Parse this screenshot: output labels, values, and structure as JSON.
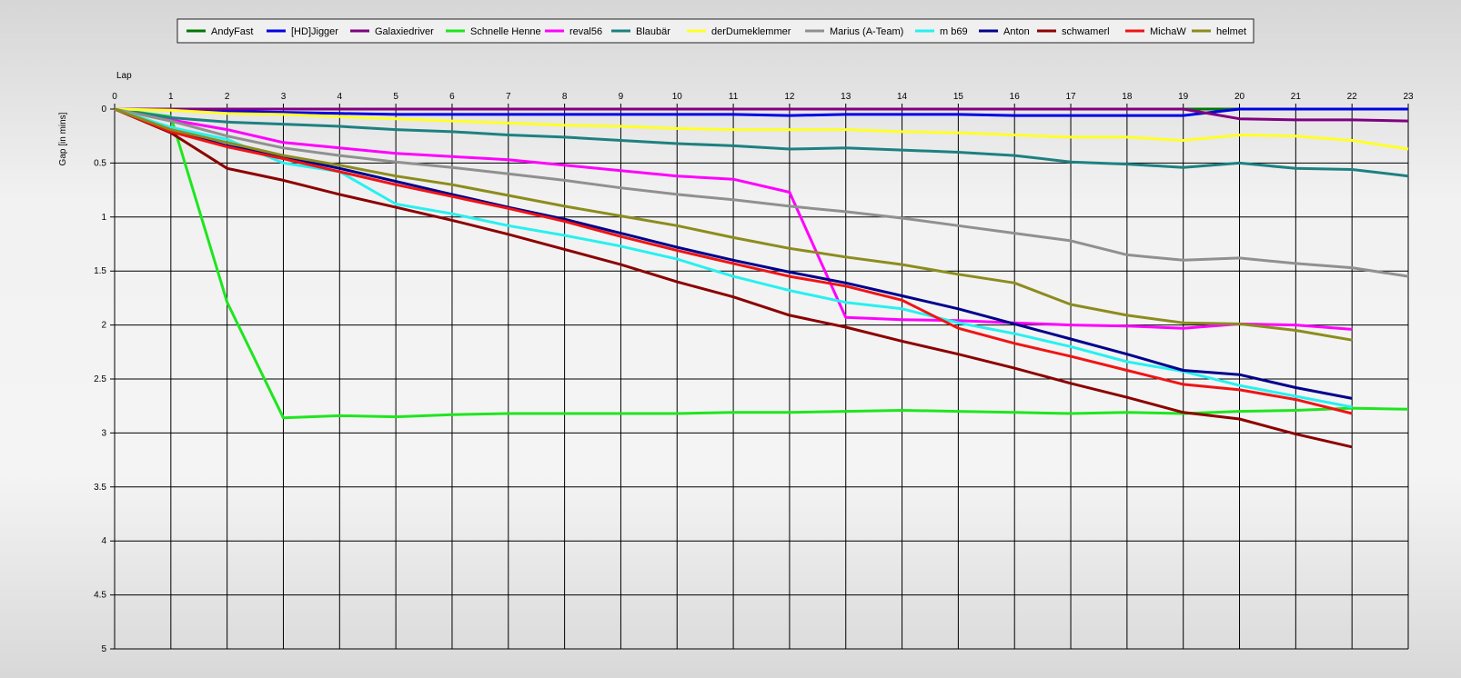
{
  "chart_data": {
    "type": "line",
    "xlabel": "Lap",
    "ylabel": "Gap [in mins]",
    "xlim": [
      0,
      23
    ],
    "ylim": [
      0,
      5
    ],
    "y_inverted": true,
    "grid": true,
    "legend_position": "top",
    "x_ticks": [
      "0",
      "1",
      "2",
      "3",
      "4",
      "5",
      "6",
      "7",
      "8",
      "9",
      "10",
      "11",
      "12",
      "13",
      "14",
      "15",
      "16",
      "17",
      "18",
      "19",
      "20",
      "21",
      "22",
      "23"
    ],
    "y_ticks": [
      "0",
      "0.5",
      "1",
      "1.5",
      "2",
      "2.5",
      "3",
      "3.5",
      "4",
      "4.5",
      "5"
    ],
    "series": [
      {
        "name": "AndyFast",
        "color": "#007800",
        "x": [
          0,
          1,
          2,
          3,
          4,
          5,
          6,
          7,
          8,
          9,
          10,
          11,
          12,
          13,
          14,
          15,
          16,
          17,
          18,
          19,
          20,
          21,
          22,
          23
        ],
        "values": [
          0,
          0,
          0,
          0,
          0,
          0,
          0,
          0,
          0,
          0,
          0,
          0,
          0,
          0,
          0,
          0,
          0,
          0,
          0,
          0,
          0,
          0,
          0,
          0
        ]
      },
      {
        "name": "[HD]Jigger",
        "color": "#0000e6",
        "x": [
          0,
          1,
          2,
          3,
          4,
          5,
          6,
          7,
          8,
          9,
          10,
          11,
          12,
          13,
          14,
          15,
          16,
          17,
          18,
          19,
          20,
          21,
          22,
          23
        ],
        "values": [
          0,
          0,
          0.02,
          0.03,
          0.04,
          0.05,
          0.05,
          0.05,
          0.05,
          0.05,
          0.05,
          0.05,
          0.06,
          0.05,
          0.05,
          0.05,
          0.06,
          0.06,
          0.06,
          0.06,
          0,
          0,
          0,
          0
        ]
      },
      {
        "name": "Galaxiedriver",
        "color": "#800080",
        "x": [
          0,
          1,
          2,
          3,
          4,
          5,
          6,
          7,
          8,
          9,
          10,
          11,
          12,
          13,
          14,
          15,
          16,
          17,
          18,
          19,
          20,
          21,
          22,
          23
        ],
        "values": [
          0,
          0,
          0,
          0,
          0,
          0,
          0,
          0,
          0,
          0,
          0,
          0,
          0,
          0,
          0,
          0,
          0,
          0,
          0,
          0,
          0.09,
          0.1,
          0.1,
          0.11
        ]
      },
      {
        "name": "Schnelle Henne",
        "color": "#1ee61e",
        "x": [
          0,
          1,
          2,
          3,
          4,
          5,
          6,
          7,
          8,
          9,
          10,
          11,
          12,
          13,
          14,
          15,
          16,
          17,
          18,
          19,
          20,
          21,
          22,
          23
        ],
        "values": [
          0,
          0.07,
          1.79,
          2.86,
          2.84,
          2.85,
          2.83,
          2.82,
          2.82,
          2.82,
          2.82,
          2.81,
          2.81,
          2.8,
          2.79,
          2.8,
          2.81,
          2.82,
          2.81,
          2.82,
          2.8,
          2.79,
          2.77,
          2.78
        ]
      },
      {
        "name": "reval56",
        "color": "#ff00ff",
        "x": [
          0,
          1,
          2,
          3,
          4,
          5,
          6,
          7,
          8,
          9,
          10,
          11,
          12,
          13,
          14,
          15,
          16,
          17,
          18,
          19,
          20,
          21,
          22
        ],
        "values": [
          0,
          0.1,
          0.19,
          0.31,
          0.36,
          0.41,
          0.44,
          0.47,
          0.52,
          0.57,
          0.62,
          0.65,
          0.77,
          1.93,
          1.95,
          1.96,
          1.98,
          2,
          2.01,
          2.03,
          1.99,
          2,
          2.04
        ]
      },
      {
        "name": "Blaubär",
        "color": "#1e8080",
        "x": [
          0,
          1,
          2,
          3,
          4,
          5,
          6,
          7,
          8,
          9,
          10,
          11,
          12,
          13,
          14,
          15,
          16,
          17,
          18,
          19,
          20,
          21,
          22,
          23
        ],
        "values": [
          0,
          0.08,
          0.12,
          0.14,
          0.16,
          0.19,
          0.21,
          0.24,
          0.26,
          0.29,
          0.32,
          0.34,
          0.37,
          0.36,
          0.38,
          0.4,
          0.43,
          0.49,
          0.51,
          0.54,
          0.5,
          0.55,
          0.56,
          0.62
        ]
      },
      {
        "name": "derDumeklemmer",
        "color": "#ffff28",
        "x": [
          0,
          1,
          2,
          3,
          4,
          5,
          6,
          7,
          8,
          9,
          10,
          11,
          12,
          13,
          14,
          15,
          16,
          17,
          18,
          19,
          20,
          21,
          22,
          23
        ],
        "values": [
          0,
          0.01,
          0.04,
          0.05,
          0.07,
          0.09,
          0.11,
          0.13,
          0.15,
          0.16,
          0.18,
          0.19,
          0.19,
          0.19,
          0.21,
          0.22,
          0.24,
          0.26,
          0.26,
          0.29,
          0.24,
          0.25,
          0.29,
          0.37
        ]
      },
      {
        "name": "Marius (A-Team)",
        "color": "#909090",
        "x": [
          0,
          1,
          2,
          3,
          4,
          5,
          6,
          7,
          8,
          9,
          10,
          11,
          12,
          13,
          14,
          15,
          16,
          17,
          18,
          19,
          20,
          21,
          22,
          23
        ],
        "values": [
          0,
          0.11,
          0.25,
          0.36,
          0.43,
          0.49,
          0.54,
          0.6,
          0.66,
          0.73,
          0.79,
          0.84,
          0.9,
          0.95,
          1.01,
          1.08,
          1.15,
          1.22,
          1.35,
          1.4,
          1.38,
          1.43,
          1.47,
          1.55
        ]
      },
      {
        "name": "m b69",
        "color": "#28f0f0",
        "x": [
          0,
          1,
          2,
          3,
          4,
          5,
          6,
          7,
          8,
          9,
          10,
          11,
          12,
          13,
          14,
          15,
          16,
          17,
          18,
          19,
          20,
          21,
          22
        ],
        "values": [
          0,
          0.17,
          0.28,
          0.5,
          0.58,
          0.88,
          0.97,
          1.08,
          1.17,
          1.27,
          1.39,
          1.55,
          1.68,
          1.79,
          1.85,
          1.98,
          2.08,
          2.2,
          2.34,
          2.43,
          2.56,
          2.66,
          2.76
        ]
      },
      {
        "name": "Anton",
        "color": "#00008c",
        "x": [
          0,
          1,
          2,
          3,
          4,
          5,
          6,
          7,
          8,
          9,
          10,
          11,
          12,
          13,
          14,
          15,
          16,
          17,
          18,
          19,
          20,
          21,
          22
        ],
        "values": [
          0,
          0.2,
          0.34,
          0.44,
          0.55,
          0.67,
          0.79,
          0.91,
          1.02,
          1.15,
          1.28,
          1.4,
          1.51,
          1.61,
          1.73,
          1.85,
          1.99,
          2.13,
          2.27,
          2.42,
          2.46,
          2.58,
          2.68
        ]
      },
      {
        "name": "schwamerl",
        "color": "#8c0000",
        "x": [
          0,
          1,
          2,
          3,
          4,
          5,
          6,
          7,
          8,
          9,
          10,
          11,
          12,
          13,
          14,
          15,
          16,
          17,
          18,
          19,
          20,
          21,
          22
        ],
        "values": [
          0,
          0.22,
          0.55,
          0.66,
          0.79,
          0.91,
          1.03,
          1.16,
          1.3,
          1.44,
          1.6,
          1.74,
          1.91,
          2.02,
          2.15,
          2.27,
          2.4,
          2.54,
          2.67,
          2.81,
          2.87,
          3.01,
          3.13
        ]
      },
      {
        "name": "MichaW",
        "color": "#f01414",
        "x": [
          0,
          1,
          2,
          3,
          4,
          5,
          6,
          7,
          8,
          9,
          10,
          11,
          12,
          13,
          14,
          15,
          16,
          17,
          18,
          19,
          20,
          21,
          22
        ],
        "values": [
          0,
          0.21,
          0.35,
          0.46,
          0.58,
          0.7,
          0.81,
          0.92,
          1.04,
          1.18,
          1.31,
          1.43,
          1.55,
          1.64,
          1.77,
          2.03,
          2.17,
          2.29,
          2.42,
          2.55,
          2.6,
          2.69,
          2.82
        ]
      },
      {
        "name": "helmet",
        "color": "#8c8c1e",
        "x": [
          0,
          1,
          2,
          3,
          4,
          5,
          6,
          7,
          8,
          9,
          10,
          11,
          12,
          13,
          14,
          15,
          16,
          17,
          18,
          19,
          20,
          21,
          22
        ],
        "values": [
          0,
          0.19,
          0.31,
          0.43,
          0.52,
          0.62,
          0.7,
          0.8,
          0.9,
          0.99,
          1.08,
          1.19,
          1.29,
          1.37,
          1.44,
          1.53,
          1.61,
          1.81,
          1.91,
          1.98,
          1.99,
          2.05,
          2.14
        ]
      }
    ]
  }
}
